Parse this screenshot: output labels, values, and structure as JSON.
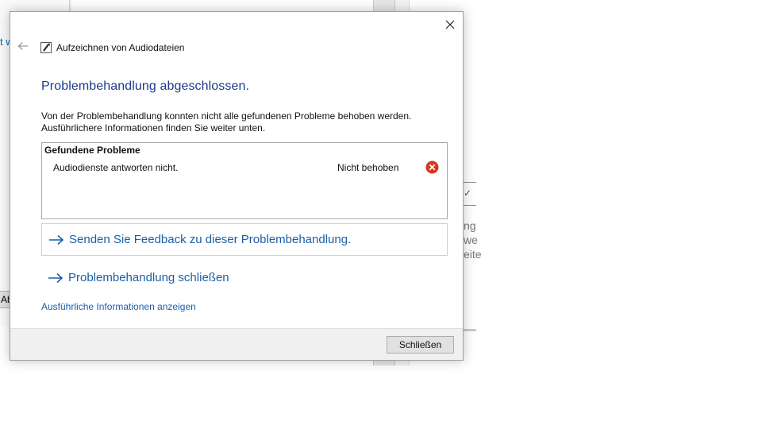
{
  "background": {
    "left_text": "t w",
    "left_button": "Ab",
    "right_texts": [
      "ng",
      "we",
      "eite"
    ],
    "right_check": "✓"
  },
  "dialog": {
    "title": "Aufzeichnen von Audiodateien",
    "heading": "Problembehandlung abgeschlossen.",
    "intro_line1": "Von der Problembehandlung konnten nicht alle gefundenen Probleme behoben werden.",
    "intro_line2": "Ausführlichere Informationen finden Sie weiter unten.",
    "problems": {
      "title": "Gefundene Probleme",
      "items": [
        {
          "name": "Audiodienste antworten nicht.",
          "status": "Nicht behoben",
          "status_icon": "error-icon"
        }
      ]
    },
    "links": {
      "feedback": "Senden Sie Feedback zu dieser Problembehandlung.",
      "close_troubleshooter": "Problembehandlung schließen",
      "details": "Ausführliche Informationen anzeigen"
    },
    "footer": {
      "close_button": "Schließen"
    }
  },
  "colors": {
    "heading": "#1e3a8a",
    "link": "#1a5fa8",
    "error": "#d9381e",
    "footer_bg": "#f0f0f0"
  }
}
